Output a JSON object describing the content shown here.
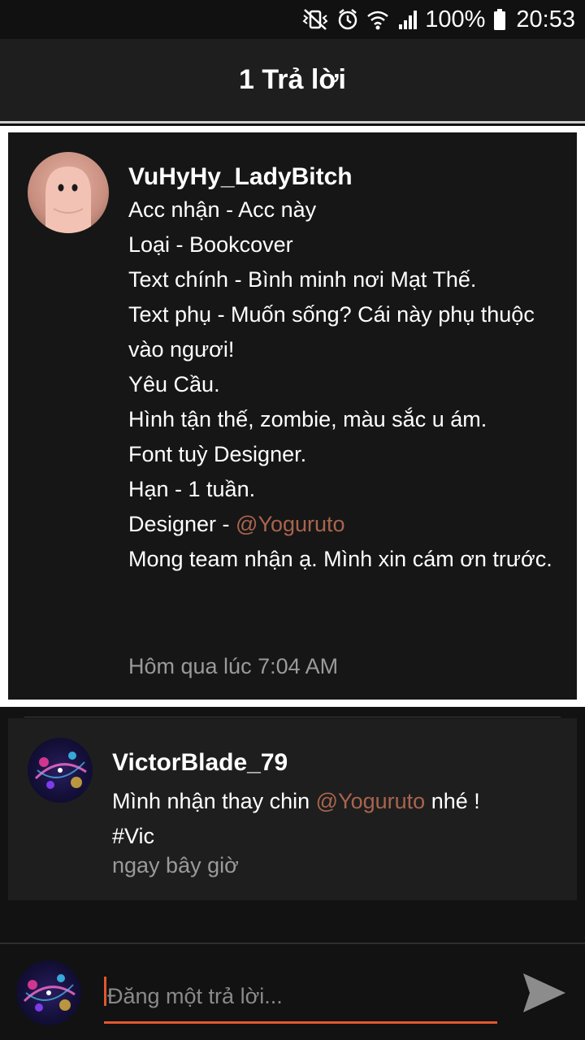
{
  "status_bar": {
    "battery": "100%",
    "clock": "20:53",
    "icons": [
      "mute-vibrate-icon",
      "alarm-icon",
      "wifi-icon",
      "signal-icon",
      "battery-icon"
    ]
  },
  "header": {
    "title": "1 Trả lời"
  },
  "post": {
    "author": "VuHyHy_LadyBitch",
    "lines": {
      "l1": "Acc nhận - Acc này",
      "l2": "Loại - Bookcover",
      "l3": "Text chính - Bình minh nơi Mạt Thế.",
      "l4": "Text phụ - Muốn sống? Cái này phụ thuộc vào ngươi!",
      "l5": "Yêu Cầu.",
      "l6": "Hình tận thế, zombie, màu sắc u ám.",
      "l7": "Font tuỳ Designer.",
      "l8": "Hạn - 1 tuần.",
      "l9_prefix": "Designer - ",
      "l9_mention": "@Yoguruto",
      "l10": "Mong team nhận ạ. Mình xin cám ơn trước."
    },
    "time": "Hôm qua lúc 7:04 AM"
  },
  "reply": {
    "author": "VictorBlade_79",
    "text_prefix": "Mình nhận thay chin ",
    "mention": "@Yoguruto",
    "text_suffix": " nhé !",
    "hashtag": "#Vic",
    "time": "ngay bây giờ"
  },
  "compose": {
    "placeholder": "Đăng một trả lời..."
  },
  "colors": {
    "accent": "#e2572f",
    "mention": "#a9644d",
    "background": "#121212",
    "card": "#1e1e1e"
  }
}
